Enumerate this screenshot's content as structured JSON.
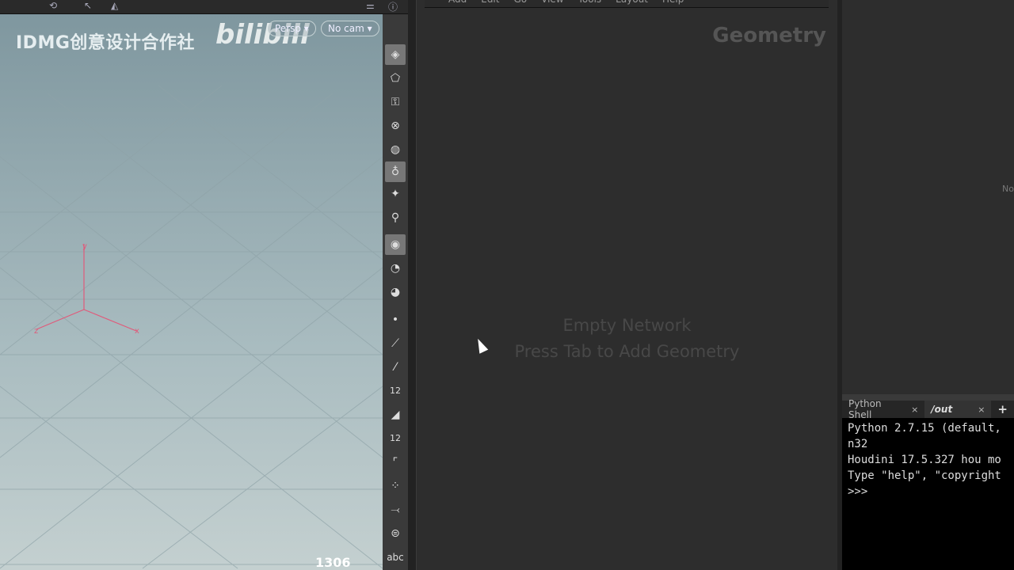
{
  "viewport": {
    "watermark": "IDMG创意设计合作社",
    "logo": "bilibili",
    "camera_view": "Persp ▾",
    "camera": "No cam ▾",
    "readout": "1306",
    "axes": {
      "x": "x",
      "y": "y",
      "z": "z"
    }
  },
  "toolbar": {
    "icons": [
      "select-display-icon",
      "geometry-icon",
      "lock-icon",
      "ghost-icon",
      "shading-icon",
      "light-icon",
      "headlight-icon",
      "ambient-icon",
      "material-icon",
      "camera-eye-icon",
      "camera-visibility-icon",
      "point-icon",
      "normal-icon",
      "vertex-normal-icon",
      "point-number-icon",
      "prim-icon",
      "prim-number-icon",
      "edge-icon",
      "uv-icon",
      "hull-icon",
      "background-icon",
      "text-icon"
    ],
    "labels": {
      "point_number": "12",
      "prim_number": "12",
      "text": "abc"
    }
  },
  "network": {
    "menu": [
      "Add",
      "Edit",
      "Go",
      "View",
      "Tools",
      "Layout",
      "Help"
    ],
    "context": "Geometry",
    "empty_title": "Empty Network",
    "empty_hint": "Press Tab to Add Geometry"
  },
  "right_pane": {
    "text": "No"
  },
  "shell": {
    "tabs": [
      {
        "label": "Python Shell",
        "active": false
      },
      {
        "label": "/out",
        "active": true
      }
    ],
    "add": "+",
    "close": "×",
    "lines": [
      "Python 2.7.15 (default,",
      "n32",
      "Houdini 17.5.327 hou mo",
      "Type \"help\", \"copyright",
      ">>>"
    ]
  }
}
